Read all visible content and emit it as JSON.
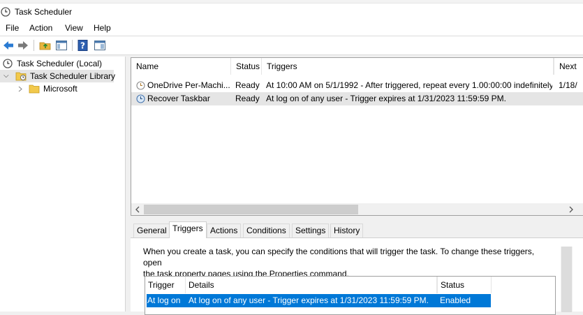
{
  "window": {
    "title": "Task Scheduler"
  },
  "menu": [
    "File",
    "Action",
    "View",
    "Help"
  ],
  "toolbar": {
    "icons": [
      "back-arrow-icon",
      "forward-arrow-icon",
      "folder-up-icon",
      "show-hide-tree-icon",
      "help-icon",
      "show-action-pane-icon"
    ]
  },
  "tree": {
    "root_label": "Task Scheduler (Local)",
    "library_label": "Task Scheduler Library",
    "child_label": "Microsoft"
  },
  "task_list": {
    "columns": [
      "Name",
      "Status",
      "Triggers",
      "Next"
    ],
    "rows": [
      {
        "name": "OneDrive Per-Machi...",
        "status": "Ready",
        "triggers": "At 10:00 AM on 5/1/1992 - After triggered, repeat every 1.00:00:00 indefinitely.",
        "next": "1/18/"
      },
      {
        "name": "Recover Taskbar",
        "status": "Ready",
        "triggers": "At log on of any user - Trigger expires at 1/31/2023 11:59:59 PM.",
        "next": ""
      }
    ]
  },
  "detail": {
    "tabs": [
      "General",
      "Triggers",
      "Actions",
      "Conditions",
      "Settings",
      "History"
    ],
    "active_tab": "Triggers",
    "description_line1": "When you create a task, you can specify the conditions that will trigger the task.  To change these triggers, open",
    "description_line2": "the task property pages using the Properties command.",
    "trigger_columns": [
      "Trigger",
      "Details",
      "Status"
    ],
    "trigger_row": {
      "trigger": "At log on",
      "details": "At log on of any user - Trigger expires at 1/31/2023 11:59:59 PM.",
      "status": "Enabled"
    }
  },
  "colors": {
    "selection": "#0078d7",
    "row_highlight": "#e5e5e5"
  }
}
